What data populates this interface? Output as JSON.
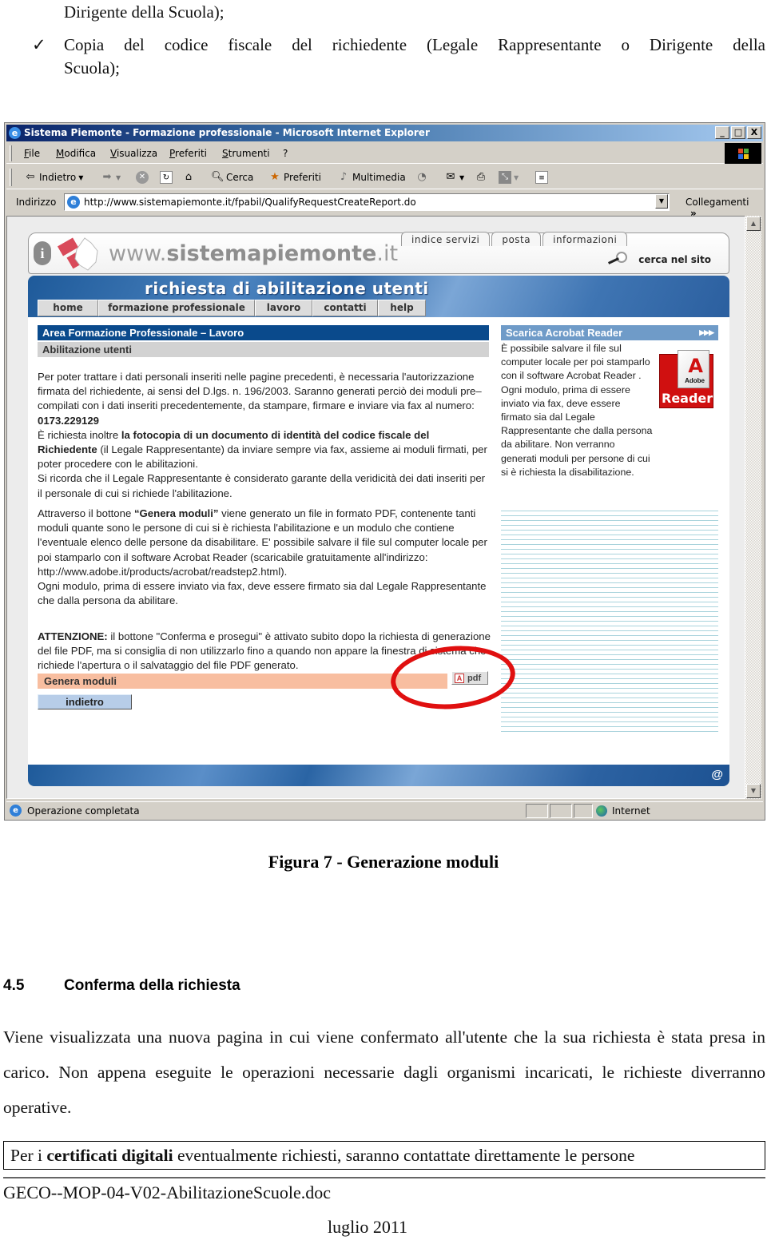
{
  "document": {
    "bullet_continuation": "Dirigente della Scuola);",
    "bullet_check": "✓",
    "bullet_text_line1": "Copia del codice fiscale del richiedente (Legale Rappresentante o Dirigente della",
    "bullet_text_line2": "Scuola);",
    "caption": "Figura 7 - Generazione moduli",
    "section_number": "4.5",
    "section_title": "Conferma della richiesta",
    "paragraph": "Viene visualizzata una nuova pagina in cui viene confermato all'utente che la sua richiesta è stata presa in carico. Non appena eseguite le operazioni necessarie dagli organismi incaricati, le richieste diverranno operative.",
    "boxed_prefix": "Per i ",
    "boxed_bold": "certificati digitali",
    "boxed_suffix": " eventualmente richiesti, saranno contattate direttamente le persone",
    "footer_docname": "GECO--MOP-04-V02-AbilitazioneScuole.doc",
    "footer_date": "luglio 2011"
  },
  "browser": {
    "title": "Sistema Piemonte - Formazione professionale - Microsoft Internet Explorer",
    "window_buttons": [
      "_",
      "□",
      "X"
    ],
    "menu": [
      "File",
      "Modifica",
      "Visualizza",
      "Preferiti",
      "Strumenti",
      "?"
    ],
    "toolbar": {
      "back": "Indietro",
      "search": "Cerca",
      "favorites": "Preferiti",
      "media": "Multimedia"
    },
    "address_label": "Indirizzo",
    "address_url": "http://www.sistemapiemonte.it/fpabil/QualifyRequestCreateReport.do",
    "links_label": "Collegamenti",
    "links_chevron": "»",
    "status_text": "Operazione completata",
    "status_zone": "Internet"
  },
  "site": {
    "brand_prefix": "www.",
    "brand_bold": "sistemapiemonte",
    "brand_suffix": ".it",
    "top_tabs": [
      "indice servizi",
      "posta",
      "informazioni"
    ],
    "search_label": "cerca nel sito",
    "banner_title": "richiesta di abilitazione utenti",
    "nav": [
      "home",
      "formazione professionale",
      "lavoro",
      "contatti",
      "help"
    ],
    "area_title": "Area Formazione Professionale – Lavoro",
    "sub_title": "Abilitazione utenti",
    "p1_a": "Per poter trattare i dati personali inseriti nelle pagine precedenti, è necessaria l'autorizzazione firmata del richiedente, ai sensi del D.lgs. n. 196/2003. Saranno generati perciò dei moduli pre–compilati con i dati inseriti precedentemente, da stampare, firmare e inviare via fax al numero: ",
    "p1_fax": "0173.229129",
    "p1_b": "È richiesta inoltre ",
    "p1_bold": "la fotocopia di un documento di identità del codice fiscale del Richiedente",
    "p1_c": " (il Legale Rappresentante) da inviare sempre via fax, assieme ai moduli firmati, per poter procedere con le abilitazioni.",
    "p1_d": "Si ricorda che il Legale Rappresentante è considerato garante della veridicità dei dati inseriti per il personale di cui si richiede l'abilitazione.",
    "p2_a": "Attraverso il bottone ",
    "p2_bold": "“Genera moduli”",
    "p2_b": " viene generato un file in formato PDF, contenente tanti moduli quante sono le persone di cui si è richiesta l'abilitazione e un modulo che contiene l'eventuale elenco delle persone da disabilitare. E' possibile salvare il file sul computer locale per poi stamparlo con il software Acrobat Reader (scaricabile gratuitamente all'indirizzo: http://www.adobe.it/products/acrobat/readstep2.html).",
    "p2_c": "Ogni modulo, prima di essere inviato via fax, deve essere firmato sia dal Legale Rappresentante che dalla persona da abilitare.",
    "p3_bold": "ATTENZIONE:",
    "p3": " il bottone \"Conferma e prosegui\" è attivato subito dopo la richiesta di generazione del file PDF, ma si consiglia di non utilizzarlo fino a quando non appare la finestra di sistema che richiede l'apertura o il salvataggio del file PDF generato.",
    "genera_label": "Genera moduli",
    "pdf_label": "pdf",
    "back_label": "indietro",
    "side_title": "Scarica Acrobat Reader",
    "side_arrows": "▶▶▶",
    "side_text": "È possibile salvare il file sul computer locale per poi stamparlo con il software Acrobat Reader . Ogni modulo, prima di essere inviato via fax, deve essere firmato sia dal Legale Rappresentante che dalla persona da abilitare. Non verranno generati moduli per persone di cui si è richiesta la disabilitazione.",
    "reader_badge_top": "Adobe",
    "reader_badge_bottom": "Reader",
    "footer_at": "@"
  },
  "colors": {
    "annotation_circle": "#e01010",
    "area_bar": "#0a4a8c",
    "genera_bar": "#f8bea0"
  }
}
